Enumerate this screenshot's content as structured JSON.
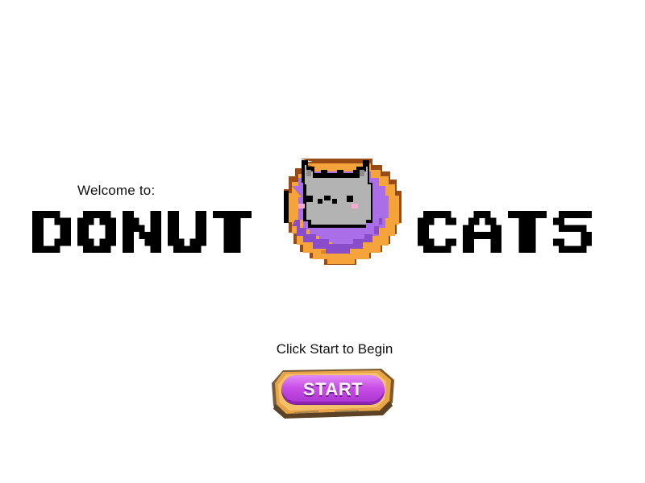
{
  "welcome_text": "Welcome to:",
  "title": {
    "left_word": "DONUT",
    "right_word": "CATS"
  },
  "logo": {
    "icon": "donut-cat-icon",
    "colors": {
      "cat_gray": "#b3b3b3",
      "icing_purple": "#a96ee8",
      "donut_orange": "#f5a33b",
      "crust_brown": "#9a4a14",
      "blush_pink": "#f5a8d0"
    }
  },
  "prompt_text": "Click Start to Begin",
  "start_button": {
    "label": "START",
    "colors": {
      "pill": "#c84de6",
      "frame": "#e8a447"
    }
  }
}
